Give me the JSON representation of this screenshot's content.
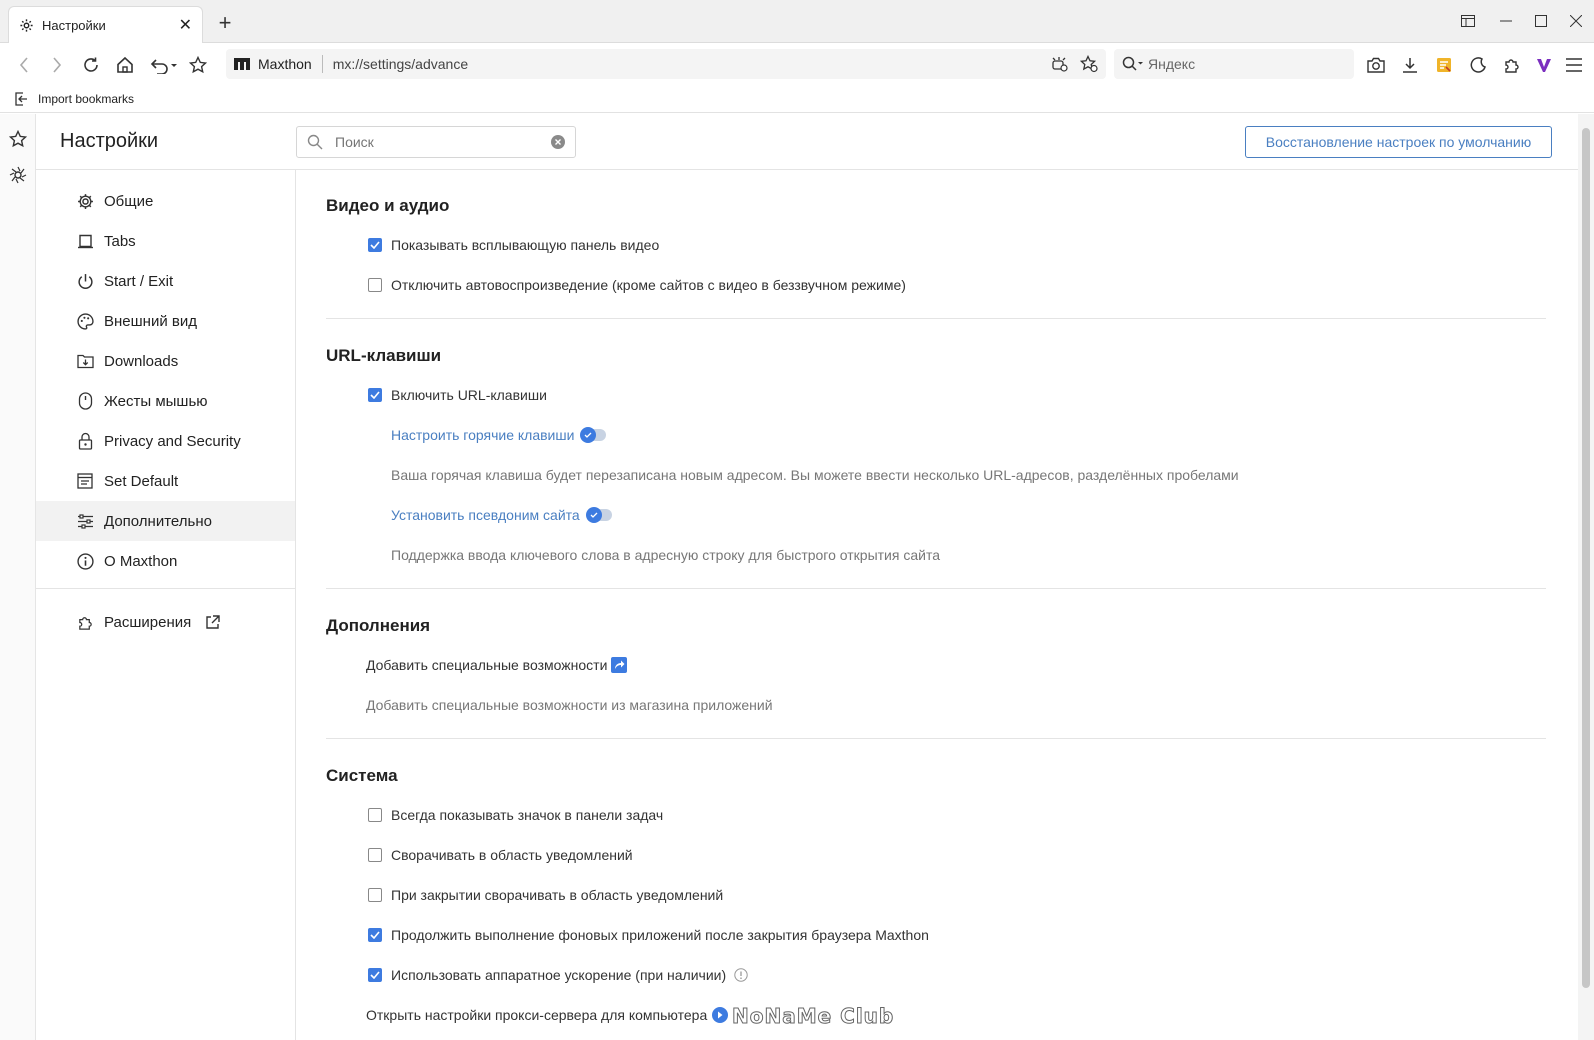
{
  "tab": {
    "title": "Настройки",
    "close": "✕"
  },
  "window": {
    "new_tab": "+"
  },
  "address": {
    "site": "Maxthon",
    "url": "mx://settings/advance"
  },
  "search_engine": {
    "placeholder": "Яндекс"
  },
  "bookmarks": {
    "import": "Import bookmarks"
  },
  "settings": {
    "title": "Настройки",
    "search_placeholder": "Поиск",
    "restore_button": "Восстановление настроек по умолчанию"
  },
  "nav": {
    "items": [
      {
        "label": "Общие",
        "icon": "gear-icon"
      },
      {
        "label": "Tabs",
        "icon": "tabs-icon"
      },
      {
        "label": "Start / Exit",
        "icon": "power-icon"
      },
      {
        "label": "Внешний вид",
        "icon": "palette-icon"
      },
      {
        "label": "Downloads",
        "icon": "download-folder-icon"
      },
      {
        "label": "Жесты мышью",
        "icon": "mouse-icon"
      },
      {
        "label": "Privacy and Security",
        "icon": "lock-icon"
      },
      {
        "label": "Set Default",
        "icon": "default-browser-icon"
      },
      {
        "label": "Дополнительно",
        "icon": "sliders-icon",
        "active": true
      },
      {
        "label": "O Maxthon",
        "icon": "info-icon"
      }
    ],
    "extensions": "Расширения"
  },
  "sections": {
    "video": {
      "title": "Видео и аудио",
      "options": [
        {
          "label": "Показывать всплывающую панель видео",
          "checked": true
        },
        {
          "label": "Отключить автовоспроизведение (кроме сайтов с видео в беззвучном режиме)",
          "checked": false
        }
      ]
    },
    "url_keys": {
      "title": "URL-клавиши",
      "enable": {
        "label": "Включить URL-клавиши",
        "checked": true
      },
      "hotkeys_link": "Настроить горячие клавиши",
      "hotkeys_hint": "Ваша горячая клавиша будет перезаписана новым адресом. Вы можете ввести несколько URL-адресов, разделённых пробелами",
      "alias_link": "Установить псевдоним сайта",
      "alias_hint": "Поддержка ввода ключевого слова в адресную строку для быстрого открытия сайта"
    },
    "addons": {
      "title": "Дополнения",
      "add_link": "Добавить специальные возможности",
      "add_hint": "Добавить специальные возможности из магазина приложений"
    },
    "system": {
      "title": "Система",
      "options": [
        {
          "label": "Всегда показывать значок в панели задач",
          "checked": false
        },
        {
          "label": "Сворачивать в область уведомлений",
          "checked": false
        },
        {
          "label": "При закрытии сворачивать в область уведомлений",
          "checked": false
        },
        {
          "label": "Продолжить выполнение фоновых приложений после закрытия браузера Maxthon",
          "checked": true
        },
        {
          "label": "Использовать аппаратное ускорение (при наличии)",
          "checked": true
        }
      ],
      "proxy": "Открыть настройки прокси-сервера для компьютера"
    }
  },
  "watermark": "NoNaMe Club",
  "colors": {
    "accent": "#3d7be0",
    "link": "#4a7fc1"
  }
}
